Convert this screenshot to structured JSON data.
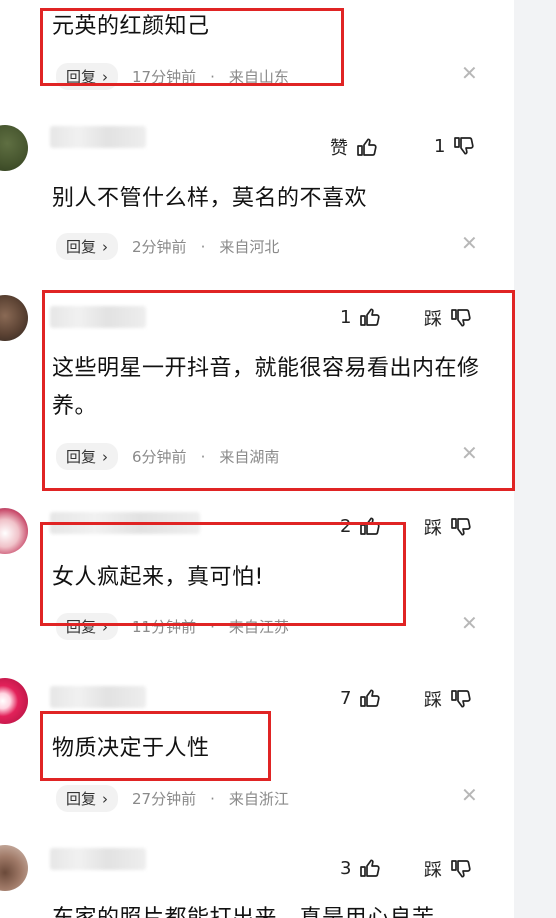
{
  "comments": [
    {
      "text": "元英的红颜知己",
      "reply_label": "回复",
      "time": "17分钟前",
      "location": "来自山东"
    },
    {
      "like_label": "赞",
      "dislike_count": "1",
      "text": "别人不管什么样，莫名的不喜欢",
      "reply_label": "回复",
      "time": "2分钟前",
      "location": "来自河北"
    },
    {
      "like_count": "1",
      "dislike_label": "踩",
      "text": "这些明星一开抖音，就能很容易看出内在修养。",
      "reply_label": "回复",
      "time": "6分钟前",
      "location": "来自湖南"
    },
    {
      "like_count": "2",
      "dislike_label": "踩",
      "text": "女人疯起来，真可怕!",
      "reply_label": "回复",
      "time": "11分钟前",
      "location": "来自江苏"
    },
    {
      "like_count": "7",
      "dislike_label": "踩",
      "text": "物质决定于人性",
      "reply_label": "回复",
      "time": "27分钟前",
      "location": "来自浙江"
    },
    {
      "like_count": "3",
      "dislike_label": "踩",
      "text": "东家的照片都能打出来，真是用心良苦"
    }
  ],
  "colors": {
    "highlight_box": "#e02424",
    "meta_text": "#8a8a8a",
    "reply_bg": "#f2f2f2"
  }
}
